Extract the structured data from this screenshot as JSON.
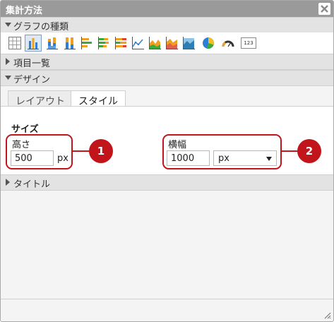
{
  "window": {
    "title": "集計方法"
  },
  "sections": {
    "chart_type": "グラフの種類",
    "items": "項目一覧",
    "design": "デザイン",
    "title": "タイトル"
  },
  "chart_icons": [
    "table-icon",
    "bar-chart-icon",
    "stacked-bar-chart-icon",
    "percent-bar-chart-icon",
    "horizontal-bar-chart-icon",
    "stacked-horizontal-bar-icon",
    "percent-horizontal-bar-icon",
    "line-chart-icon",
    "area-chart-icon",
    "stacked-area-chart-icon",
    "percent-area-chart-icon",
    "pie-chart-icon",
    "gauge-chart-icon",
    "number-card-icon"
  ],
  "number_icon_text": "123",
  "tabs": [
    {
      "label": "レイアウト",
      "active": false
    },
    {
      "label": "スタイル",
      "active": true
    }
  ],
  "size": {
    "heading": "サイズ",
    "height_label": "高さ",
    "height_value": "500",
    "height_unit": "px",
    "width_label": "横幅",
    "width_value": "1000",
    "width_unit": "px"
  },
  "callouts": [
    "1",
    "2"
  ],
  "colors": {
    "accent": "#c2141b",
    "titlebar": "#9a9a9a",
    "section": "#e3e3e3"
  }
}
